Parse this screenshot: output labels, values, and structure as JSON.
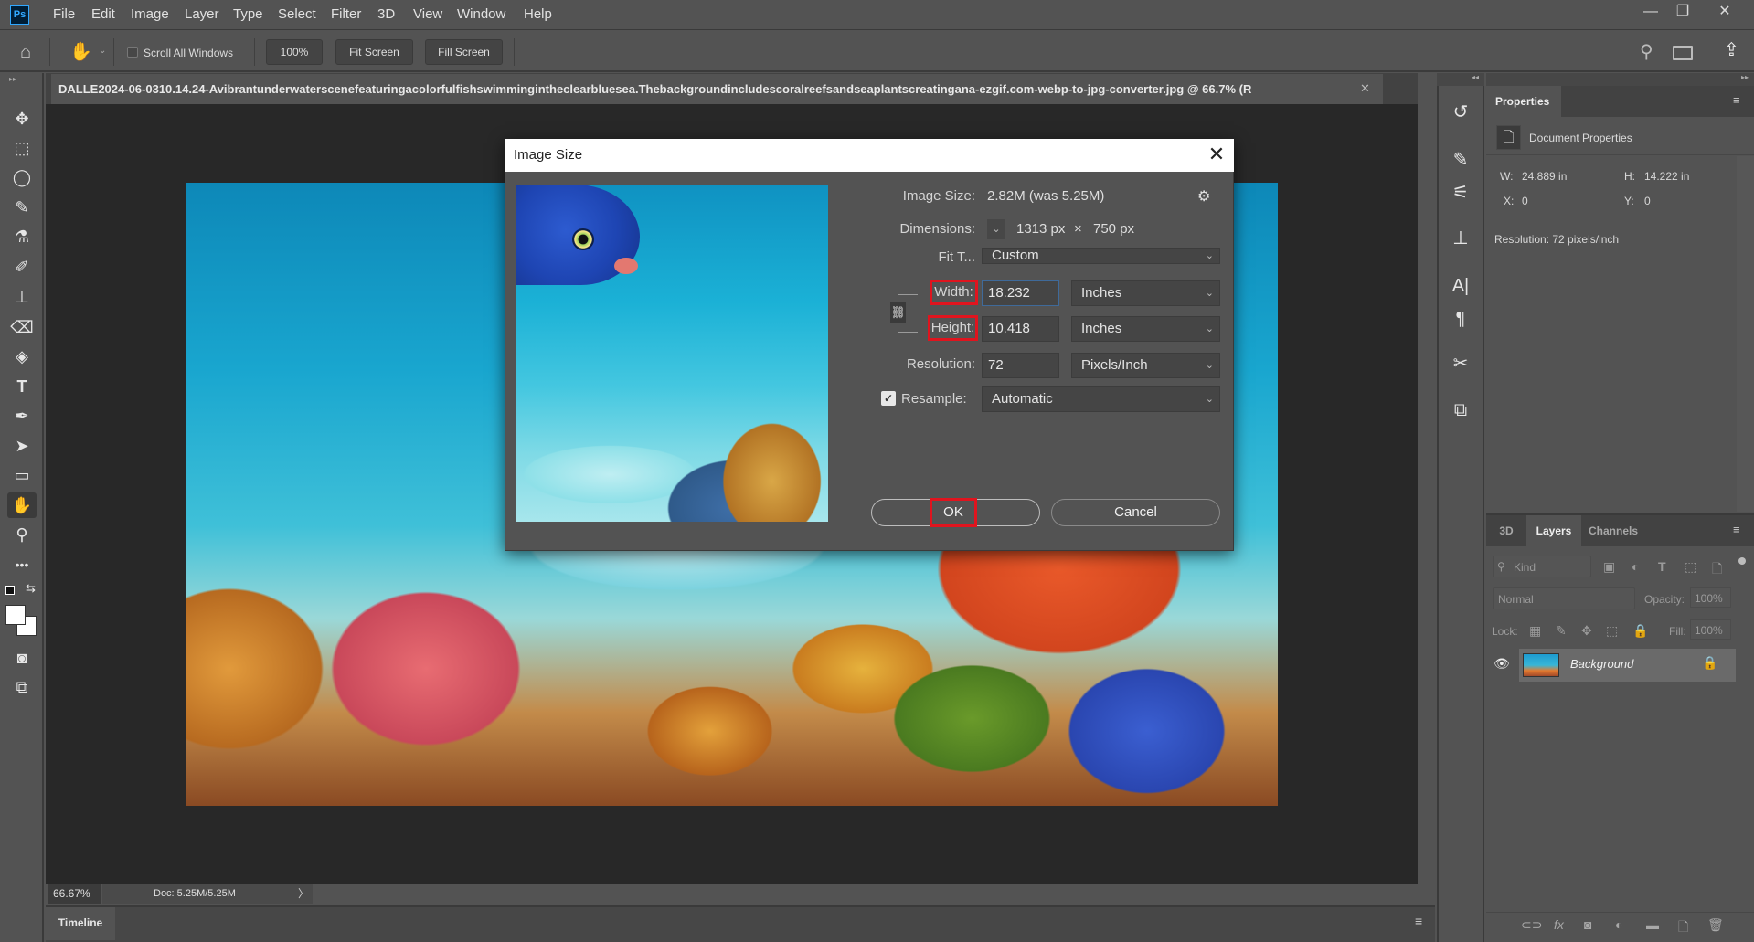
{
  "app": {
    "logo": "Ps"
  },
  "menu": [
    "File",
    "Edit",
    "Image",
    "Layer",
    "Type",
    "Select",
    "Filter",
    "3D",
    "View",
    "Window",
    "Help"
  ],
  "window_controls": {
    "minimize": "—",
    "restore": "❐",
    "close": "✕"
  },
  "options_bar": {
    "scroll_all_windows_label": "Scroll All Windows",
    "scroll_all_windows_checked": false,
    "zoom_100_label": "100%",
    "fit_screen_label": "Fit Screen",
    "fill_screen_label": "Fill Screen"
  },
  "document": {
    "tab_title": "DALLE2024-06-0310.14.24-Avibrantunderwaterscenefeaturingacolorfulfishswimmingintheclearbluesea.Thebackgroundincludescoralreefsandseaplantscreatingana-ezgif.com-webp-to-jpg-converter.jpg @ 66.7% (R",
    "close_glyph": "✕"
  },
  "status": {
    "zoom": "66.67%",
    "doc_info": "Doc: 5.25M/5.25M",
    "arrow": "〉"
  },
  "timeline": {
    "tab_label": "Timeline"
  },
  "properties": {
    "tab_label": "Properties",
    "section": "Document Properties",
    "w_label": "W:",
    "w_value": "24.889 in",
    "h_label": "H:",
    "h_value": "14.222 in",
    "x_label": "X:",
    "x_value": "0",
    "y_label": "Y:",
    "y_value": "0",
    "resolution": "Resolution: 72 pixels/inch"
  },
  "layers_panel": {
    "tabs": [
      "3D",
      "Layers",
      "Channels"
    ],
    "active_tab": "Layers",
    "kind_placeholder": "Kind",
    "blend_mode": "Normal",
    "opacity_label": "Opacity:",
    "opacity_value": "100%",
    "lock_label": "Lock:",
    "fill_label": "Fill:",
    "fill_value": "100%",
    "layers": [
      {
        "name": "Background",
        "visible": true,
        "locked": true
      }
    ]
  },
  "dialog": {
    "title": "Image Size",
    "image_size_label": "Image Size:",
    "image_size_value": "2.82M (was 5.25M)",
    "dimensions_label": "Dimensions:",
    "dimensions_w": "1313 px",
    "dimensions_x": "×",
    "dimensions_h": "750 px",
    "fit_to_label": "Fit T...",
    "fit_to_value": "Custom",
    "width_label": "Width:",
    "width_value": "18.232",
    "width_unit": "Inches",
    "height_label": "Height:",
    "height_value": "10.418",
    "height_unit": "Inches",
    "resolution_label": "Resolution:",
    "resolution_value": "72",
    "resolution_unit": "Pixels/Inch",
    "resample_label": "Resample:",
    "resample_checked": true,
    "resample_value": "Automatic",
    "ok_label": "OK",
    "cancel_label": "Cancel",
    "highlight_color": "#e0141e"
  }
}
